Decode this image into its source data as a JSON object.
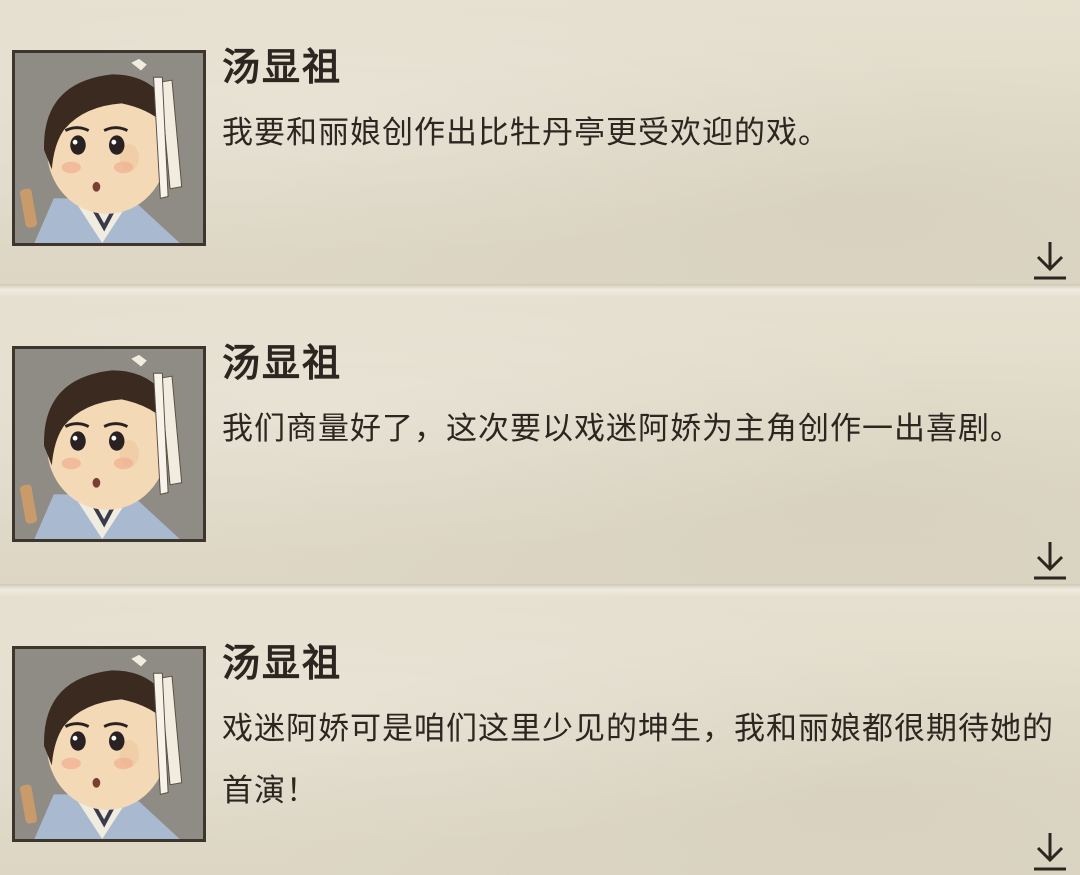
{
  "dialogue": [
    {
      "speaker": "汤显祖",
      "text": "我要和丽娘创作出比牡丹亭更受欢迎的戏。",
      "portrait_icon": "tang-xianzu-portrait",
      "advance_icon": "arrow-down-icon"
    },
    {
      "speaker": "汤显祖",
      "text": "我们商量好了，这次要以戏迷阿娇为主角创作一出喜剧。",
      "portrait_icon": "tang-xianzu-portrait",
      "advance_icon": "arrow-down-icon"
    },
    {
      "speaker": "汤显祖",
      "text": "戏迷阿娇可是咱们这里少见的坤生，我和丽娘都很期待她的首演！",
      "portrait_icon": "tang-xianzu-portrait",
      "advance_icon": "arrow-down-icon"
    }
  ],
  "colors": {
    "paper": "#e3ddcd",
    "ink": "#2b2620",
    "portrait_border": "#3d362c"
  }
}
